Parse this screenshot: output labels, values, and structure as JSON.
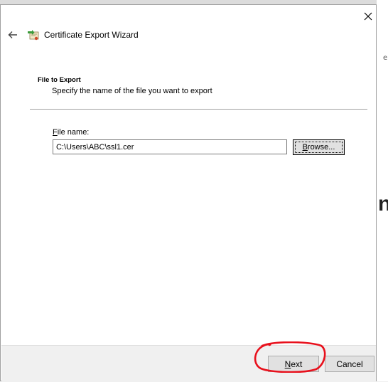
{
  "window": {
    "title": "Certificate Export Wizard",
    "close_glyph": "✕",
    "back_glyph": "←"
  },
  "page": {
    "heading": "File to Export",
    "description": "Specify the name of the file you want to export"
  },
  "file_name": {
    "label_accel": "F",
    "label_rest": "ile name:",
    "value": "C:\\Users\\ABC\\ssl1.cer"
  },
  "browse": {
    "label_accel": "B",
    "label_rest": "rowse..."
  },
  "footer": {
    "next_accel": "N",
    "next_rest": "ext",
    "cancel_label": "Cancel"
  },
  "background": {
    "right_glyph": "n",
    "right_small": "e"
  },
  "colors": {
    "dialog_bg": "#ffffff",
    "footer_bg": "#f0f0f0",
    "annotation": "#e8101c",
    "cert_icon_green": "#3a9b3a",
    "cert_icon_paper": "#f4e9c8"
  },
  "icons": {
    "close": "close-icon",
    "back": "back-arrow-icon",
    "wizard": "certificate-icon"
  }
}
